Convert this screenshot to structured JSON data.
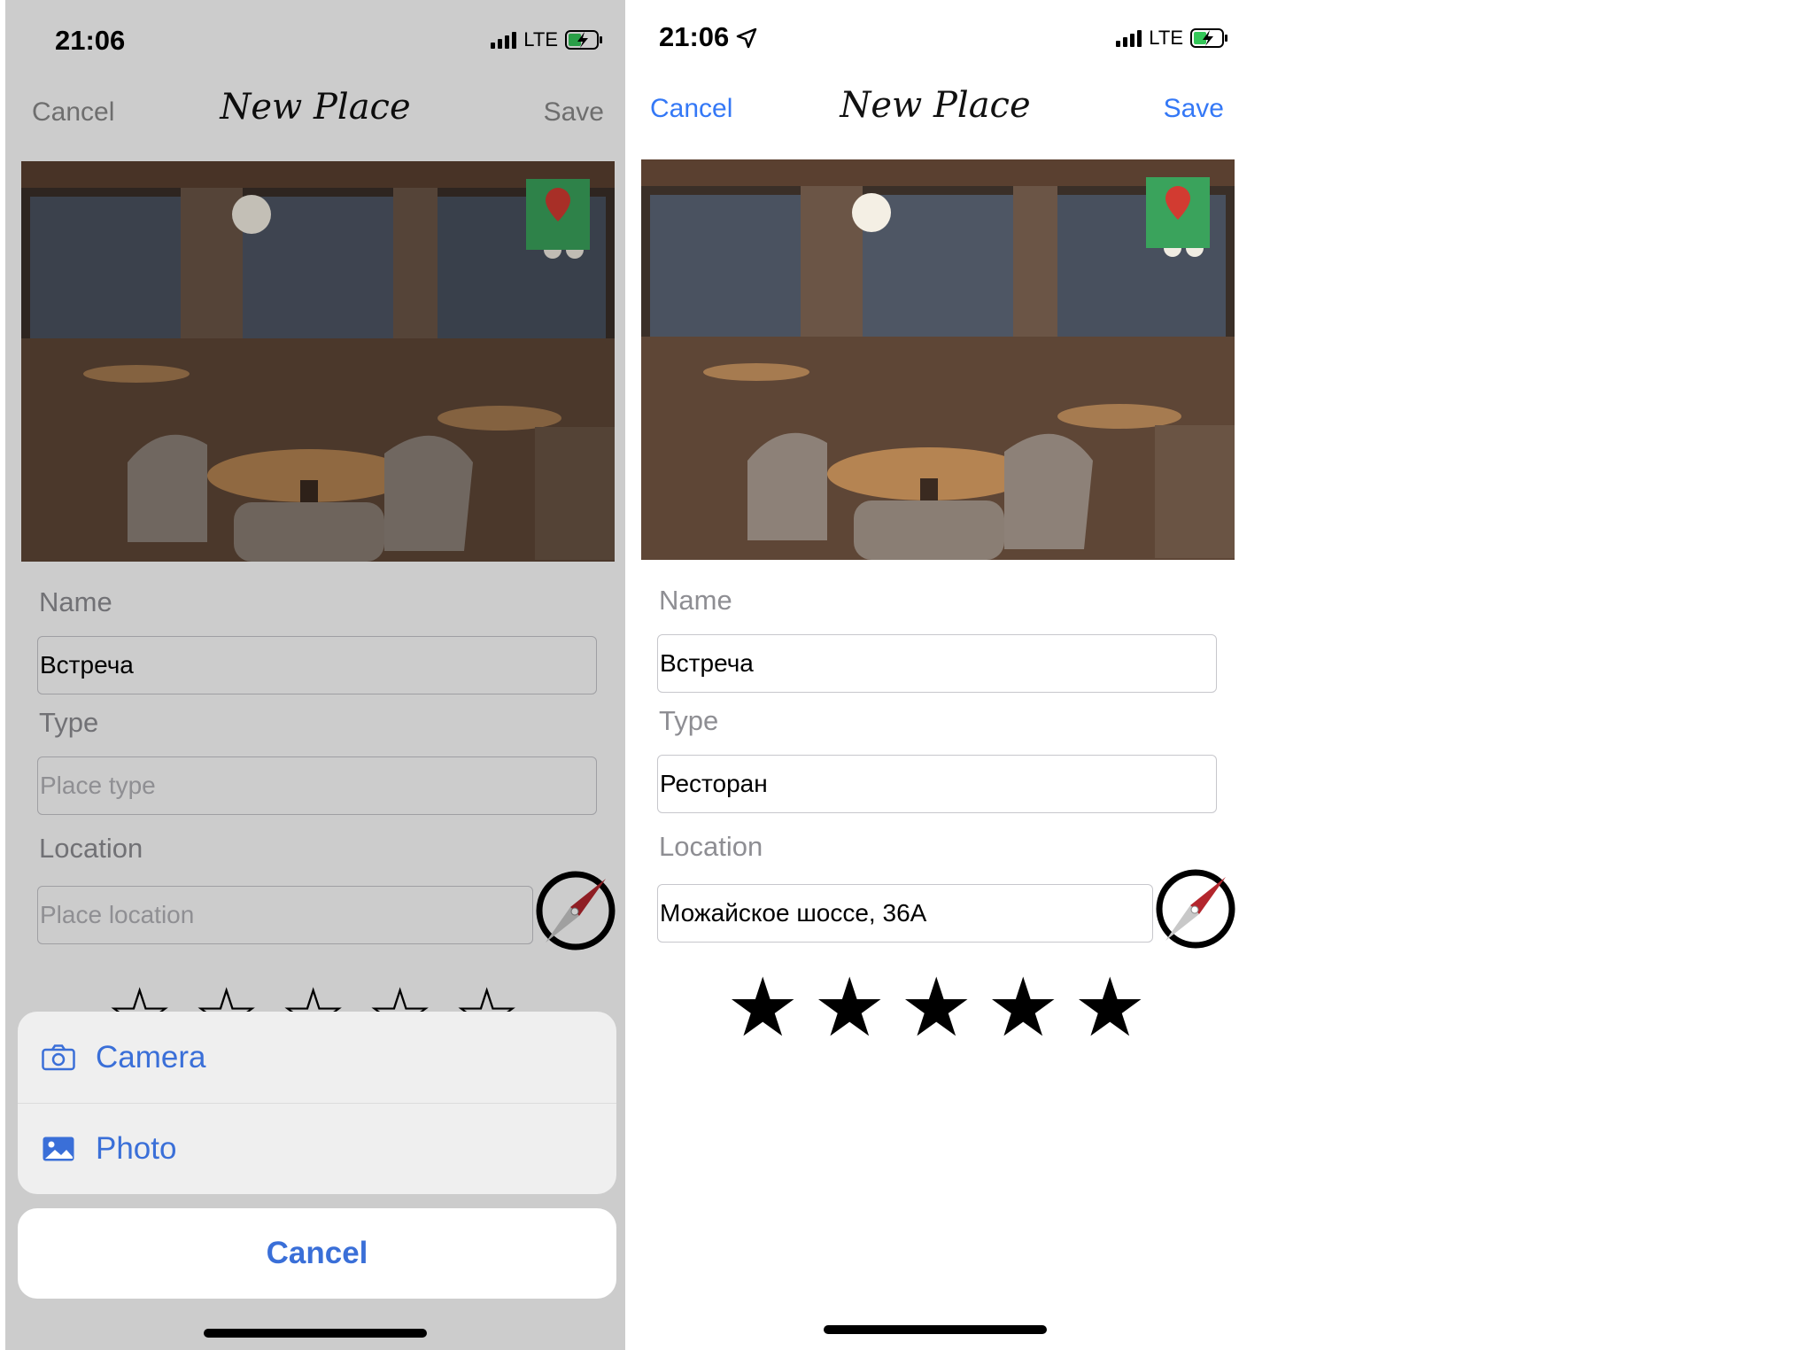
{
  "left": {
    "status": {
      "time": "21:06",
      "network": "LTE"
    },
    "nav": {
      "cancel": "Cancel",
      "title": "New Place",
      "save": "Save"
    },
    "form": {
      "name_label": "Name",
      "name_value": "Встреча",
      "type_label": "Type",
      "type_placeholder": "Place type",
      "location_label": "Location",
      "location_placeholder": "Place location",
      "rating": 0,
      "stars": [
        "☆",
        "☆",
        "☆",
        "☆",
        "☆"
      ]
    },
    "action_sheet": {
      "items": [
        {
          "label": "Camera",
          "icon": "camera-icon"
        },
        {
          "label": "Photo",
          "icon": "photo-icon"
        }
      ],
      "cancel": "Cancel"
    }
  },
  "right": {
    "status": {
      "time": "21:06",
      "network": "LTE"
    },
    "nav": {
      "cancel": "Cancel",
      "title": "New Place",
      "save": "Save"
    },
    "form": {
      "name_label": "Name",
      "name_value": "Встреча",
      "type_label": "Type",
      "type_value": "Ресторан",
      "location_label": "Location",
      "location_value": "Можайское шоссе, 36А",
      "rating": 5,
      "stars": [
        "★",
        "★",
        "★",
        "★",
        "★"
      ]
    }
  },
  "colors": {
    "accent": "#3478f6",
    "sheet_accent": "#3a6fd8",
    "compass_red": "#b3262d"
  }
}
